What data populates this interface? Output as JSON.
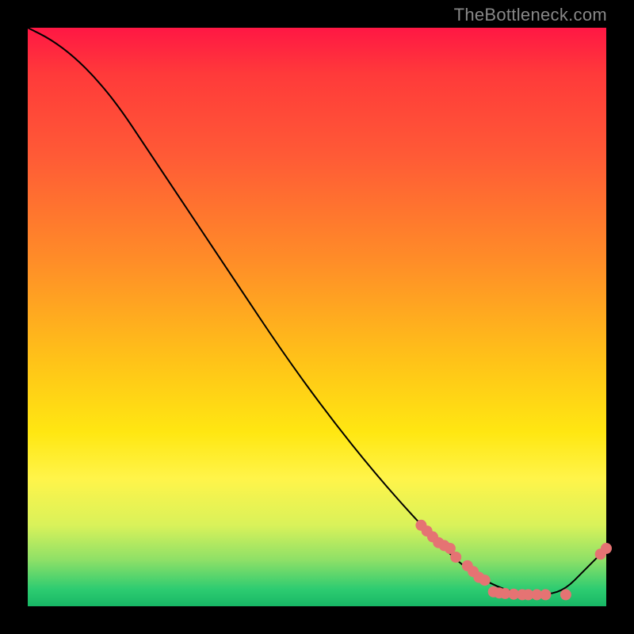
{
  "watermark": "TheBottleneck.com",
  "chart_data": {
    "type": "line",
    "title": "",
    "xlabel": "",
    "ylabel": "",
    "xlim": [
      0,
      100
    ],
    "ylim": [
      0,
      100
    ],
    "grid": false,
    "legend": false,
    "series": [
      {
        "name": "curve",
        "color": "#000000",
        "x": [
          0,
          4,
          8,
          12,
          16,
          20,
          28,
          36,
          44,
          52,
          60,
          68,
          74,
          78,
          82,
          86,
          90,
          93,
          96,
          100
        ],
        "y": [
          100,
          98,
          95,
          91,
          86,
          80,
          68,
          56,
          44,
          33,
          23,
          14,
          8,
          5,
          3,
          2,
          2,
          3,
          6,
          10
        ]
      }
    ],
    "markers": [
      {
        "name": "dots",
        "color": "#e57373",
        "radius": 7,
        "points_xy": [
          [
            68,
            14
          ],
          [
            69,
            13
          ],
          [
            70,
            12
          ],
          [
            71,
            11
          ],
          [
            72,
            10.5
          ],
          [
            73,
            10
          ],
          [
            74,
            8.5
          ],
          [
            76,
            7
          ],
          [
            77,
            6
          ],
          [
            78,
            5
          ],
          [
            79,
            4.5
          ],
          [
            80.5,
            2.5
          ],
          [
            81.5,
            2.3
          ],
          [
            82.5,
            2.2
          ],
          [
            84,
            2.1
          ],
          [
            85.5,
            2.0
          ],
          [
            86.5,
            2.0
          ],
          [
            88,
            2.0
          ],
          [
            89.5,
            2.0
          ],
          [
            93,
            2.0
          ],
          [
            99,
            9
          ],
          [
            100,
            10
          ]
        ]
      }
    ]
  }
}
